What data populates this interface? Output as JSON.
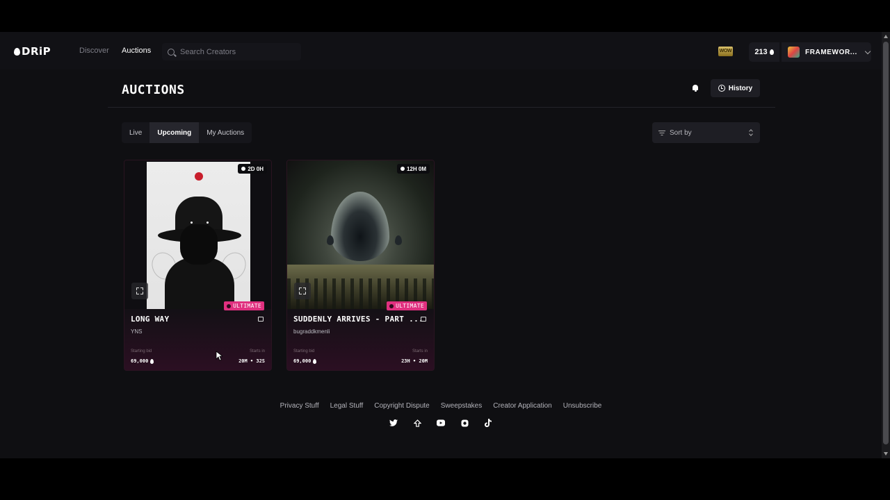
{
  "brand": {
    "name": "DRiP"
  },
  "nav": {
    "discover": "Discover",
    "auctions": "Auctions"
  },
  "search": {
    "placeholder": "Search Creators"
  },
  "header": {
    "badge_text": "WOW",
    "credits": "213",
    "account_name": "FRAMEWOR..."
  },
  "page": {
    "title": "AUCTIONS",
    "history_label": "History"
  },
  "tabs": [
    {
      "label": "Live",
      "active": false
    },
    {
      "label": "Upcoming",
      "active": true
    },
    {
      "label": "My Auctions",
      "active": false
    }
  ],
  "sort": {
    "placeholder": "Sort by"
  },
  "cards": [
    {
      "timer": "2D 0H",
      "badge": "ULTIMATE",
      "title": "LONG WAY",
      "creator": "YNS",
      "starting_bid_label": "Starting bid",
      "starting_bid": "69,000",
      "starts_in_label": "Starts in",
      "starts_in": "20M • 32S"
    },
    {
      "timer": "12H 0M",
      "badge": "ULTIMATE",
      "title": "SUDDENLY ARRIVES - PART ...",
      "creator": "bugraddkmenli",
      "starting_bid_label": "Starting bid",
      "starting_bid": "69,000",
      "starts_in_label": "Starts in",
      "starts_in": "23H • 20M"
    }
  ],
  "footer": {
    "links": [
      "Privacy Stuff",
      "Legal Stuff",
      "Copyright Dispute",
      "Sweepstakes",
      "Creator Application",
      "Unsubscribe"
    ],
    "socials": [
      "twitter-icon",
      "tensor-icon",
      "youtube-icon",
      "instagram-icon",
      "tiktok-icon"
    ]
  },
  "colors": {
    "accent": "#e0307f",
    "background": "#0f0f12"
  }
}
